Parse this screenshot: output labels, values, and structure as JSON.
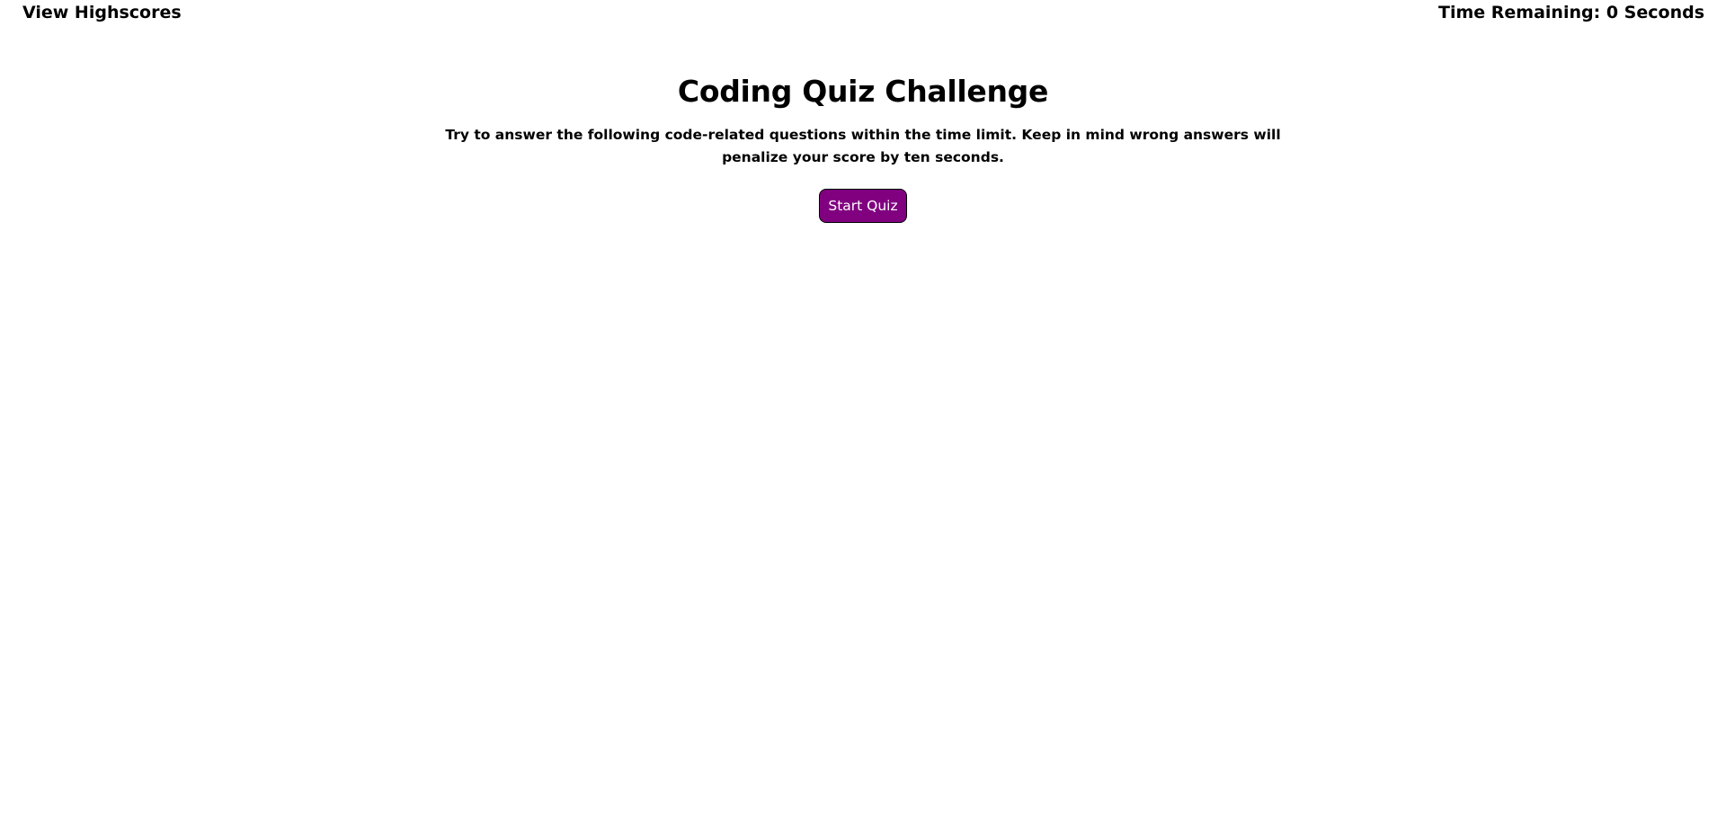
{
  "header": {
    "highscores_label": "View Highscores",
    "timer_prefix": "Time Remaining: ",
    "timer_value": "0",
    "timer_suffix": " Seconds"
  },
  "main": {
    "title": "Coding Quiz Challenge",
    "intro": "Try to answer the following code-related questions within the time limit. Keep in mind wrong answers will penalize your score by ten seconds.",
    "start_label": "Start Quiz"
  },
  "colors": {
    "accent": "#800080",
    "background": "#ffffff",
    "text": "#000000"
  }
}
